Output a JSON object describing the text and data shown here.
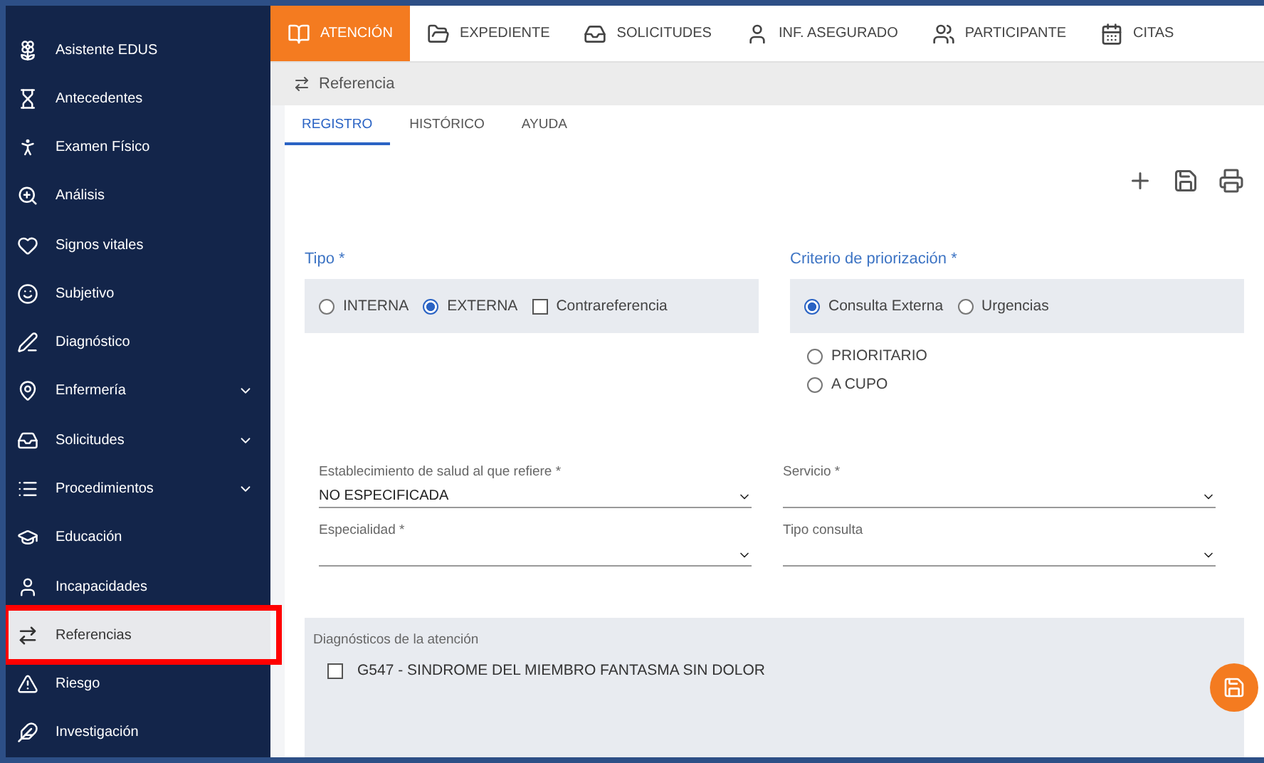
{
  "sidebar": {
    "items": [
      {
        "label": "Asistente EDUS",
        "expandable": false,
        "selected": false
      },
      {
        "label": "Antecedentes",
        "expandable": false,
        "selected": false
      },
      {
        "label": "Examen Físico",
        "expandable": false,
        "selected": false
      },
      {
        "label": "Análisis",
        "expandable": false,
        "selected": false
      },
      {
        "label": "Signos vitales",
        "expandable": false,
        "selected": false
      },
      {
        "label": "Subjetivo",
        "expandable": false,
        "selected": false
      },
      {
        "label": "Diagnóstico",
        "expandable": false,
        "selected": false
      },
      {
        "label": "Enfermería",
        "expandable": true,
        "selected": false
      },
      {
        "label": "Solicitudes",
        "expandable": true,
        "selected": false
      },
      {
        "label": "Procedimientos",
        "expandable": true,
        "selected": false
      },
      {
        "label": "Educación",
        "expandable": false,
        "selected": false
      },
      {
        "label": "Incapacidades",
        "expandable": false,
        "selected": false
      },
      {
        "label": "Referencias",
        "expandable": false,
        "selected": true
      },
      {
        "label": "Riesgo",
        "expandable": false,
        "selected": false
      },
      {
        "label": "Investigación",
        "expandable": false,
        "selected": false
      }
    ]
  },
  "top_tabs": [
    {
      "label": "ATENCIÓN",
      "selected": true
    },
    {
      "label": "EXPEDIENTE",
      "selected": false
    },
    {
      "label": "SOLICITUDES",
      "selected": false
    },
    {
      "label": "INF. ASEGURADO",
      "selected": false
    },
    {
      "label": "PARTICIPANTE",
      "selected": false
    },
    {
      "label": "CITAS",
      "selected": false
    }
  ],
  "section_title": "Referencia",
  "sub_tabs": [
    {
      "label": "REGISTRO",
      "selected": true
    },
    {
      "label": "HISTÓRICO",
      "selected": false
    },
    {
      "label": "AYUDA",
      "selected": false
    }
  ],
  "tipo": {
    "label": "Tipo *",
    "options": [
      {
        "label": "INTERNA",
        "selected": false
      },
      {
        "label": "EXTERNA",
        "selected": true
      }
    ],
    "contrarreferencia": {
      "label": "Contrareferencia",
      "checked": false
    }
  },
  "criterio": {
    "label": "Criterio de priorización *",
    "options": [
      {
        "label": "Consulta Externa",
        "selected": true
      },
      {
        "label": "Urgencias",
        "selected": false
      }
    ],
    "sub_options": [
      {
        "label": "PRIORITARIO",
        "selected": false
      },
      {
        "label": "A CUPO",
        "selected": false
      }
    ]
  },
  "fields": [
    {
      "label": "Establecimiento de salud al que refiere *",
      "value": "NO ESPECIFICADA"
    },
    {
      "label": "Servicio *"
    },
    {
      "label": "Especialidad *"
    },
    {
      "label": "Tipo consulta"
    }
  ],
  "diagnosticos": {
    "title": "Diagnósticos de la atención",
    "items": [
      {
        "label": "G547 - SINDROME DEL MIEMBRO FANTASMA SIN DOLOR",
        "checked": false
      }
    ]
  }
}
